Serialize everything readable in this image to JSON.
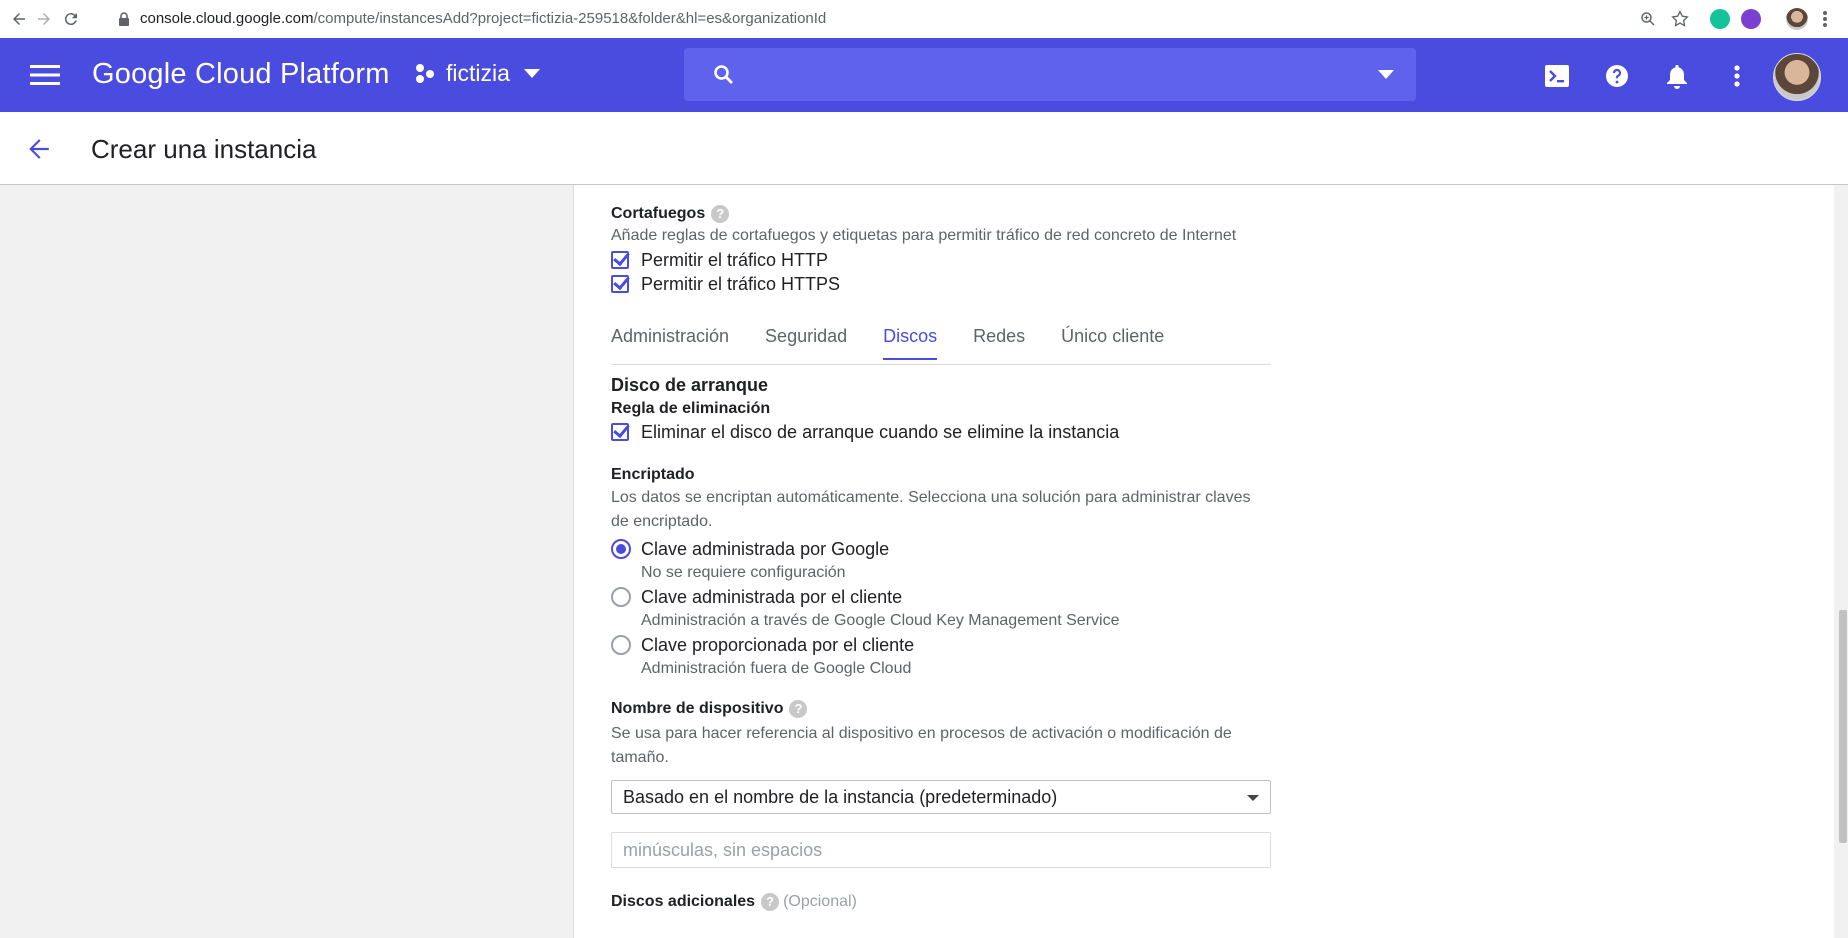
{
  "browser": {
    "url_host": "console.cloud.google.com",
    "url_path": "/compute/instancesAdd?project=fictizia-259518&folder&hl=es&organizationId"
  },
  "header": {
    "brand": "Google Cloud Platform",
    "project": "fictizia",
    "search_placeholder": ""
  },
  "page": {
    "title": "Crear una instancia"
  },
  "firewall": {
    "title": "Cortafuegos",
    "description": "Añade reglas de cortafuegos y etiquetas para permitir tráfico de red concreto de Internet",
    "options": [
      {
        "label": "Permitir el tráfico HTTP",
        "checked": true
      },
      {
        "label": "Permitir el tráfico HTTPS",
        "checked": true
      }
    ]
  },
  "tabs": [
    {
      "label": "Administración",
      "active": false
    },
    {
      "label": "Seguridad",
      "active": false
    },
    {
      "label": "Discos",
      "active": true
    },
    {
      "label": "Redes",
      "active": false
    },
    {
      "label": "Único cliente",
      "active": false
    }
  ],
  "boot_disk": {
    "title": "Disco de arranque",
    "deletion_rule_title": "Regla de eliminación",
    "deletion_rule_option": "Eliminar el disco de arranque cuando se elimine la instancia",
    "deletion_rule_checked": true
  },
  "encryption": {
    "title": "Encriptado",
    "description": "Los datos se encriptan automáticamente. Selecciona una solución para administrar claves de encriptado.",
    "options": [
      {
        "label": "Clave administrada por Google",
        "sub": "No se requiere configuración",
        "selected": true
      },
      {
        "label": "Clave administrada por el cliente",
        "sub": "Administración a través de Google Cloud Key Management Service",
        "selected": false
      },
      {
        "label": "Clave proporcionada por el cliente",
        "sub": "Administración fuera de Google Cloud",
        "selected": false
      }
    ]
  },
  "device_name": {
    "title": "Nombre de dispositivo",
    "description": "Se usa para hacer referencia al dispositivo en procesos de activación o modificación de tamaño.",
    "select_value": "Basado en el nombre de la instancia (predeterminado)",
    "input_placeholder": "minúsculas, sin espacios"
  },
  "additional_disks": {
    "title": "Discos adicionales",
    "optional": "(Opcional)"
  },
  "colors": {
    "primary": "#4a4ce0",
    "header_bg": "#4a4ce0",
    "search_bg": "#5e62ec"
  },
  "icons": {
    "back": "arrow-left-icon",
    "menu": "hamburger-icon",
    "search": "search-icon",
    "terminal": "cloud-shell-icon",
    "help": "help-icon",
    "notifications": "bell-icon",
    "more": "more-vert-icon"
  }
}
